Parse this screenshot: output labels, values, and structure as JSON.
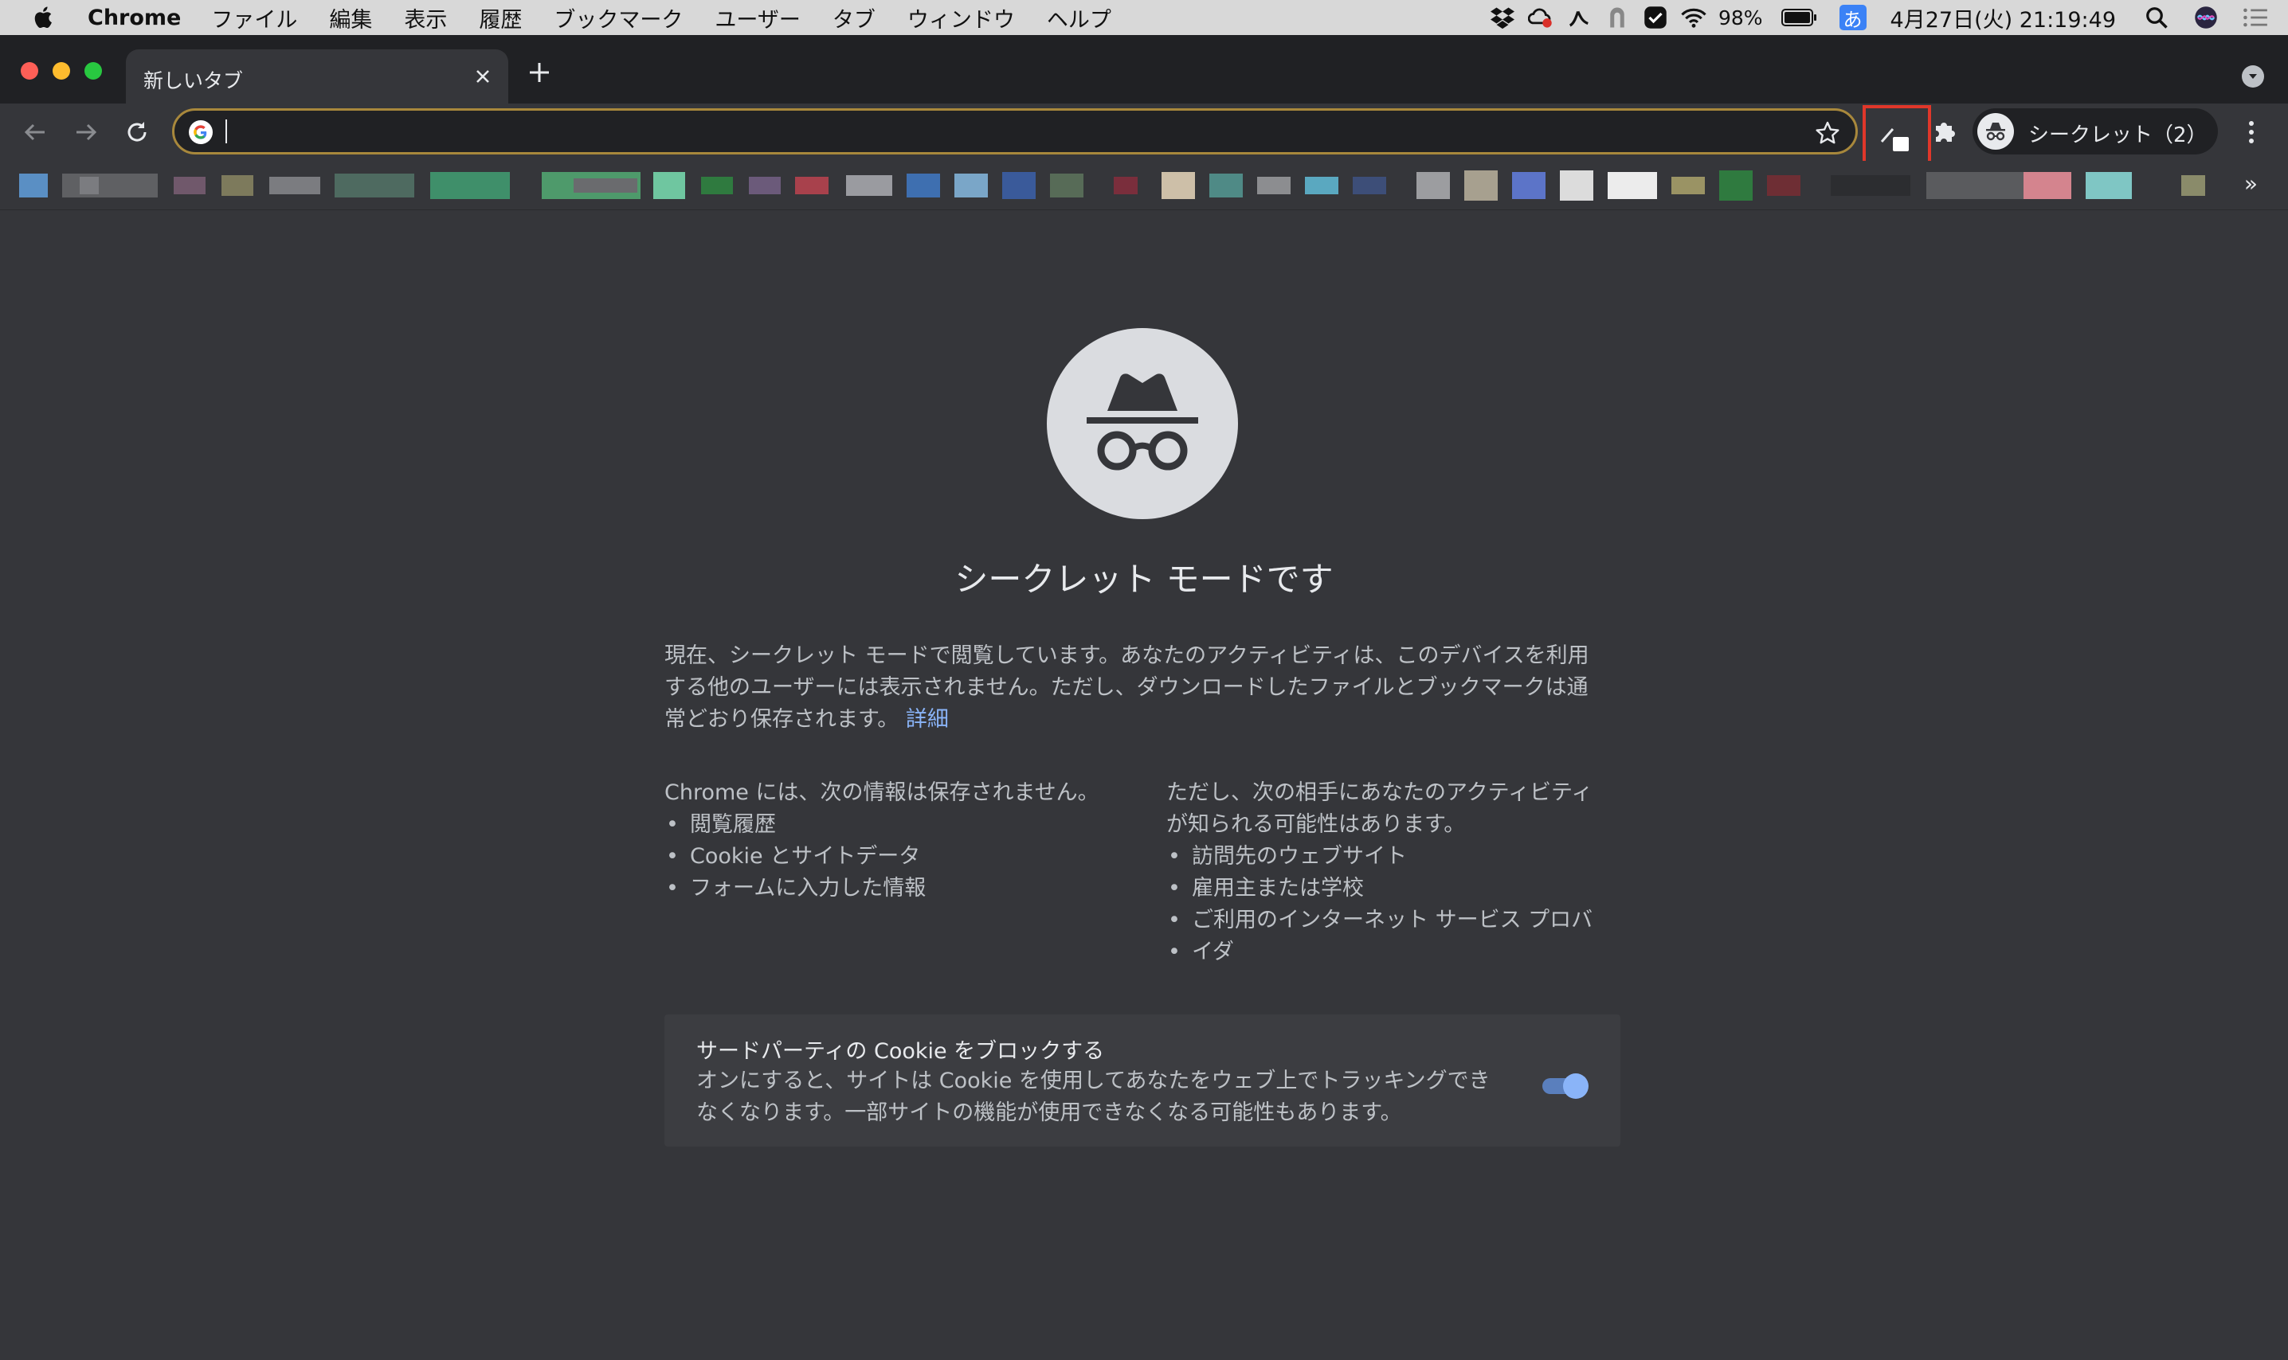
{
  "menubar": {
    "app_name": "Chrome",
    "items": [
      "ファイル",
      "編集",
      "表示",
      "履歴",
      "ブックマーク",
      "ユーザー",
      "タブ",
      "ウィンドウ",
      "ヘルプ"
    ],
    "battery": "98%",
    "ime": "あ",
    "datetime": "4月27日(火)  21:19:49",
    "tray_icons": [
      "dropbox-icon",
      "creative-cloud-icon",
      "script-icon",
      "vpn-icon",
      "check-icon",
      "wifi-icon",
      "battery-icon"
    ]
  },
  "tab": {
    "title": "新しいタブ"
  },
  "omnibox": {
    "value": ""
  },
  "profile": {
    "label": "シークレット（2）"
  },
  "bookmarks": {
    "overflow": "»"
  },
  "incognito": {
    "headline": "シークレット モードです",
    "intro_line1": "現在、シークレット モードで閲覧しています。あなたのアクティビティは、このデバイスを利用",
    "intro_line2": "する他のユーザーには表示されません。ただし、ダウンロードしたファイルとブックマークは通",
    "intro_line3": "常どおり保存されます。",
    "learn_more": "詳細",
    "not_saved_heading": "Chrome には、次の情報は保存されません。",
    "not_saved_items": [
      "閲覧履歴",
      "Cookie とサイトデータ",
      "フォームに入力した情報"
    ],
    "visible_heading_line1": "ただし、次の相手にあなたのアクティビティ",
    "visible_heading_line2": "が知られる可能性はあります。",
    "visible_items": [
      "訪問先のウェブサイト",
      "雇用主または学校",
      "ご利用のインターネット サービス プロバ",
      "イダ"
    ],
    "cookie_title": "サードパーティの Cookie をブロックする",
    "cookie_desc_line1": "オンにすると、サイトは Cookie を使用してあなたをウェブ上でトラッキングでき",
    "cookie_desc_line2": "なくなります。一部サイトの機能が使用できなくなる可能性もあります。",
    "cookie_toggle_on": true
  },
  "colors": {
    "toolbar": "#35363a",
    "tabstrip": "#202124",
    "omnibox_focus": "#a8883c",
    "link": "#8ab4f8",
    "highlight": "#e0372a"
  }
}
